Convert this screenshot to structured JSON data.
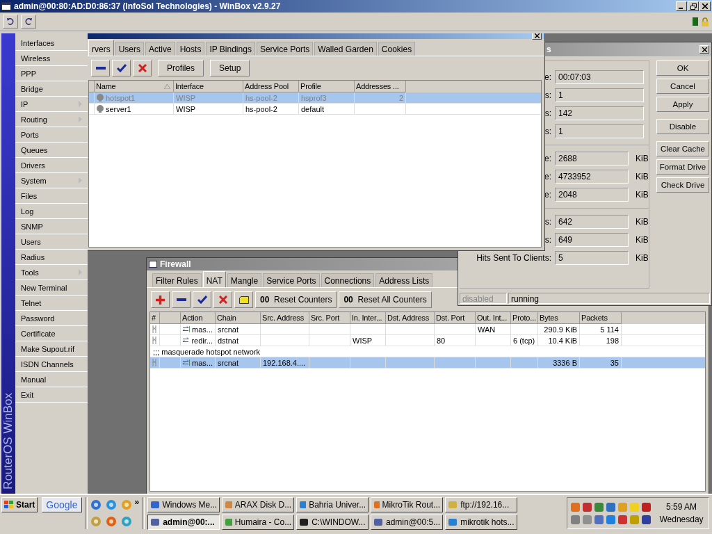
{
  "window": {
    "title": "admin@00:80:AD:D0:86:37 (InfoSol Technologies) - WinBox v2.9.27"
  },
  "menu": {
    "brand": "RouterOS WinBox",
    "items": [
      {
        "label": "Interfaces",
        "submenu": false
      },
      {
        "label": "Wireless",
        "submenu": false
      },
      {
        "label": "PPP",
        "submenu": false
      },
      {
        "label": "Bridge",
        "submenu": false
      },
      {
        "label": "IP",
        "submenu": true
      },
      {
        "label": "Routing",
        "submenu": true
      },
      {
        "label": "Ports",
        "submenu": false
      },
      {
        "label": "Queues",
        "submenu": false
      },
      {
        "label": "Drivers",
        "submenu": false
      },
      {
        "label": "System",
        "submenu": true
      },
      {
        "label": "Files",
        "submenu": false
      },
      {
        "label": "Log",
        "submenu": false
      },
      {
        "label": "SNMP",
        "submenu": false
      },
      {
        "label": "Users",
        "submenu": false
      },
      {
        "label": "Radius",
        "submenu": false
      },
      {
        "label": "Tools",
        "submenu": true
      },
      {
        "label": "New Terminal",
        "submenu": false
      },
      {
        "label": "Telnet",
        "submenu": false
      },
      {
        "label": "Password",
        "submenu": false
      },
      {
        "label": "Certificate",
        "submenu": false
      },
      {
        "label": "Make Supout.rif",
        "submenu": false
      },
      {
        "label": "ISDN Channels",
        "submenu": false
      },
      {
        "label": "Manual",
        "submenu": false
      },
      {
        "label": "Exit",
        "submenu": false
      }
    ]
  },
  "hotspot": {
    "tabs": [
      {
        "label": "rvers",
        "selected": true
      },
      {
        "label": "Users",
        "selected": false
      },
      {
        "label": "Active",
        "selected": false
      },
      {
        "label": "Hosts",
        "selected": false
      },
      {
        "label": "IP Bindings",
        "selected": false
      },
      {
        "label": "Service Ports",
        "selected": false
      },
      {
        "label": "Walled Garden",
        "selected": false
      },
      {
        "label": "Cookies",
        "selected": false
      }
    ],
    "buttons": [
      "Profiles",
      "Setup"
    ],
    "columns": [
      "Name",
      "Interface",
      "Address Pool",
      "Profile",
      "Addresses ..."
    ],
    "rows": [
      {
        "selected": true,
        "disabled": true,
        "cells": [
          "hotspot1",
          "WISP",
          "hs-pool-2",
          "hsprof3",
          "2"
        ]
      },
      {
        "selected": false,
        "disabled": false,
        "cells": [
          "server1",
          "WISP",
          "hs-pool-2",
          "default",
          null
        ]
      }
    ]
  },
  "cache": {
    "title": "s",
    "groups": [
      [
        {
          "label": "e:",
          "value": "00:07:03"
        },
        {
          "label": "s:",
          "value": "1"
        },
        {
          "label": "s:",
          "value": "142"
        },
        {
          "label": "s:",
          "value": "1"
        }
      ],
      [
        {
          "label": "e:",
          "value": "2688",
          "unit": "KiB"
        },
        {
          "label": "e:",
          "value": "4733952",
          "unit": "KiB"
        },
        {
          "label": "e:",
          "value": "2048",
          "unit": "KiB"
        }
      ],
      [
        {
          "label": "s:",
          "value": "642",
          "unit": "KiB"
        },
        {
          "label": "s:",
          "value": "649",
          "unit": "KiB"
        },
        {
          "label": "Hits Sent To Clients:",
          "value": "5",
          "unit": "KiB"
        }
      ]
    ],
    "buttons": [
      "OK",
      "Cancel",
      "Apply",
      "Disable",
      "Clear Cache",
      "Format Drive",
      "Check Drive"
    ],
    "status": [
      {
        "text": "disabled",
        "disabled": true
      },
      {
        "text": "running",
        "disabled": false
      }
    ]
  },
  "firewall": {
    "title": "Firewall",
    "tabs": [
      {
        "label": "Filter Rules",
        "selected": false
      },
      {
        "label": "NAT",
        "selected": true
      },
      {
        "label": "Mangle",
        "selected": false
      },
      {
        "label": "Service Ports",
        "selected": false
      },
      {
        "label": "Connections",
        "selected": false
      },
      {
        "label": "Address Lists",
        "selected": false
      }
    ],
    "counter_buttons": [
      {
        "prefix": "00",
        "label": "Reset Counters"
      },
      {
        "prefix": "00",
        "label": "Reset All Counters"
      }
    ],
    "columns": [
      "#",
      null,
      "Action",
      "Chain",
      "Src. Address",
      "Src. Port",
      "In. Inter...",
      "Dst. Address",
      "Dst. Port",
      "Out. Int...",
      "Proto...",
      "Bytes",
      "Packets"
    ],
    "rows": [
      {
        "kind": "rule",
        "selected": false,
        "cells": [
          "mas...",
          "srcnat",
          null,
          null,
          null,
          null,
          null,
          "WAN",
          null,
          "290.9 KiB",
          "5 114"
        ]
      },
      {
        "kind": "rule",
        "selected": false,
        "cells": [
          "redir...",
          "dstnat",
          null,
          null,
          "WISP",
          null,
          "80",
          null,
          "6 (tcp)",
          "10.4 KiB",
          "198"
        ]
      },
      {
        "kind": "comment",
        "selected": false,
        "text": ";;; masquerade hotspot network"
      },
      {
        "kind": "rule",
        "selected": true,
        "cells": [
          "mas...",
          "srcnat",
          "192.168.4....",
          null,
          null,
          null,
          null,
          null,
          null,
          "3336 B",
          "35"
        ]
      }
    ]
  },
  "taskbar": {
    "start": "Start",
    "search": "Google",
    "more": "»",
    "tasks": [
      {
        "label": "Windows Me...",
        "selected": false
      },
      {
        "label": "ARAX Disk D...",
        "selected": false
      },
      {
        "label": "Bahria Univer...",
        "selected": false
      },
      {
        "label": "MikroTik Rout...",
        "selected": false
      },
      {
        "label": "ftp://192.16...",
        "selected": false
      },
      {
        "label": "admin@00:...",
        "selected": true
      },
      {
        "label": "Humaira - Co...",
        "selected": false
      },
      {
        "label": "C:\\WINDOW...",
        "selected": false
      },
      {
        "label": "admin@00:5...",
        "selected": false
      },
      {
        "label": "mikrotik hots...",
        "selected": false
      }
    ],
    "time": "5:59 AM",
    "day": "Wednesday"
  }
}
